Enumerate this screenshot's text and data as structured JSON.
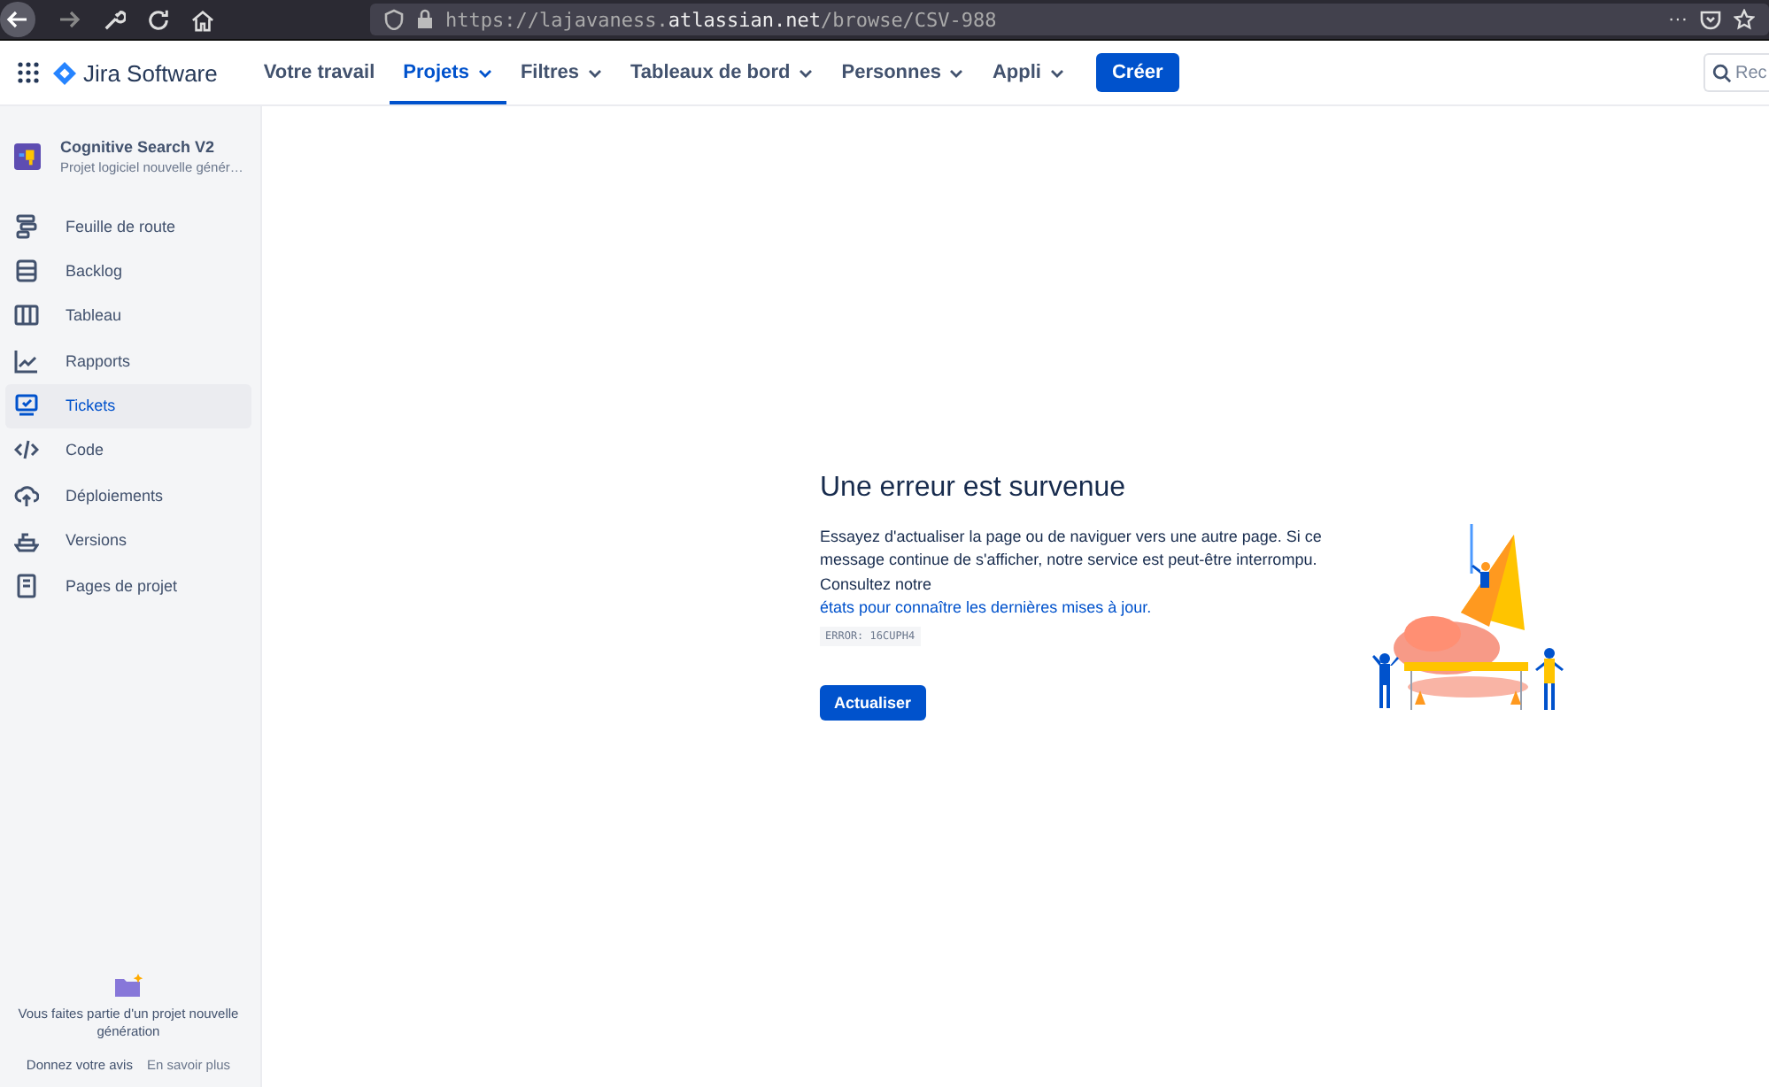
{
  "browser": {
    "url_prefix": "https://lajavaness.",
    "url_domain": "atlassian.net",
    "url_path": "/browse/CSV-988",
    "menu": "···"
  },
  "nav": {
    "product": "Jira Software",
    "items": [
      {
        "label": "Votre travail",
        "dropdown": false,
        "selected": false
      },
      {
        "label": "Projets",
        "dropdown": true,
        "selected": true
      },
      {
        "label": "Filtres",
        "dropdown": true,
        "selected": false
      },
      {
        "label": "Tableaux de bord",
        "dropdown": true,
        "selected": false
      },
      {
        "label": "Personnes",
        "dropdown": true,
        "selected": false
      },
      {
        "label": "Appli",
        "dropdown": true,
        "selected": false
      }
    ],
    "create": "Créer",
    "search_placeholder": "Rec"
  },
  "sidebar": {
    "project_name": "Cognitive Search V2",
    "project_type": "Projet logiciel nouvelle génér…",
    "items": [
      {
        "label": "Feuille de route",
        "selected": false
      },
      {
        "label": "Backlog",
        "selected": false
      },
      {
        "label": "Tableau",
        "selected": false
      },
      {
        "label": "Rapports",
        "selected": false
      },
      {
        "label": "Tickets",
        "selected": true
      },
      {
        "label": "Code",
        "selected": false
      },
      {
        "label": "Déploiements",
        "selected": false
      },
      {
        "label": "Versions",
        "selected": false
      },
      {
        "label": "Pages de projet",
        "selected": false
      }
    ],
    "footer_text": "Vous faites partie d'un projet nouvelle génération",
    "feedback": "Donnez votre avis",
    "learn_more": "En savoir plus"
  },
  "error": {
    "title": "Une erreur est survenue",
    "message": "Essayez d'actualiser la page ou de naviguer vers une autre page. Si ce message continue de s'afficher, notre service est peut-être interrompu. Consultez notre",
    "link": "états pour connaître les dernières mises à jour.",
    "code": "ERROR: 16CUPH4",
    "button": "Actualiser"
  }
}
